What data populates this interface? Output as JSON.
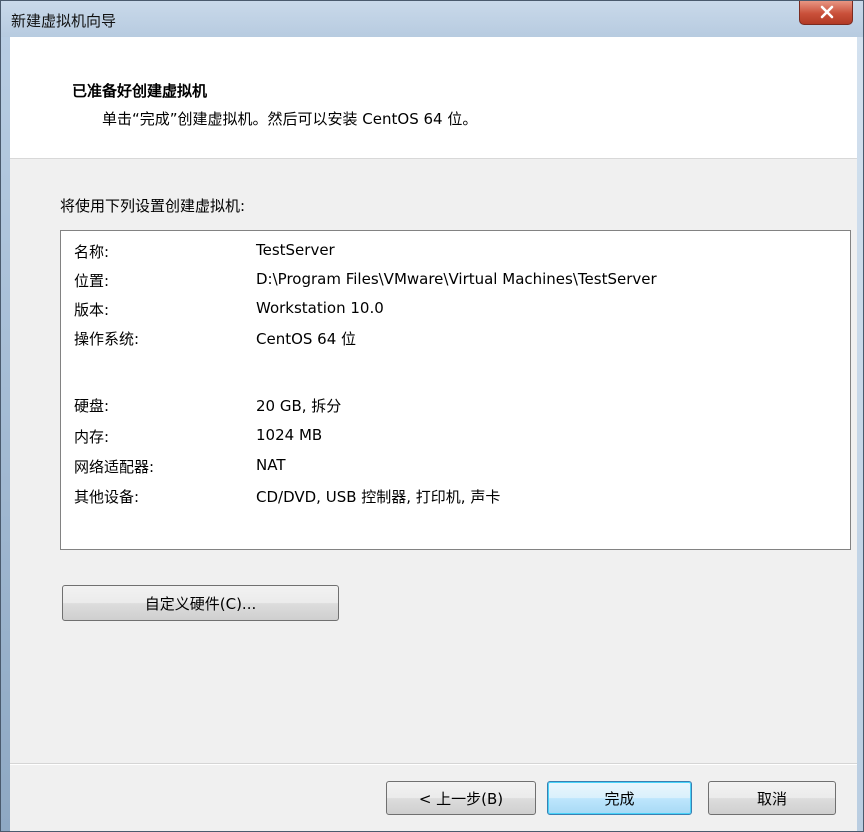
{
  "window": {
    "title": "新建虚拟机向导",
    "close_label": "X"
  },
  "header": {
    "title": "已准备好创建虚拟机",
    "subtitle": "单击“完成”创建虚拟机。然后可以安装 CentOS 64 位。"
  },
  "intro": "将使用下列设置创建虚拟机:",
  "summary": [
    {
      "label": "名称:",
      "value": "TestServer"
    },
    {
      "label": "位置:",
      "value": "D:\\Program Files\\VMware\\Virtual Machines\\TestServer"
    },
    {
      "label": "版本:",
      "value": "Workstation 10.0"
    },
    {
      "label": "操作系统:",
      "value": "CentOS 64 位"
    },
    {
      "label": "硬盘:",
      "value": "20 GB, 拆分"
    },
    {
      "label": "内存:",
      "value": "1024 MB"
    },
    {
      "label": "网络适配器:",
      "value": "NAT"
    },
    {
      "label": "其他设备:",
      "value": "CD/DVD, USB 控制器, 打印机, 声卡"
    }
  ],
  "buttons": {
    "customize": "自定义硬件(C)...",
    "back": "< 上一步(B)",
    "finish": "完成",
    "cancel": "取消"
  },
  "colors": {
    "title_bar": "#c9d9ea",
    "close_button": "#c9503a",
    "client_bg": "#f0f0f0",
    "default_button_border": "#3c7fb1"
  }
}
